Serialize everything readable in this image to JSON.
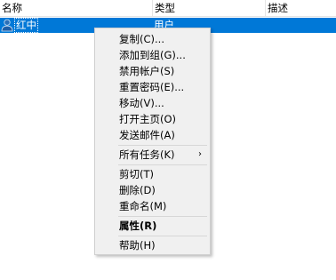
{
  "columns": {
    "name": "名称",
    "type": "类型",
    "description": "描述"
  },
  "selected_row": {
    "name": "红中",
    "type": "用户",
    "icon": "user-icon"
  },
  "menu": {
    "copy": "复制(C)...",
    "add_to_group": "添加到组(G)...",
    "disable_account": "禁用帐户(S)",
    "reset_password": "重置密码(E)...",
    "move": "移动(V)...",
    "open_home_page": "打开主页(O)",
    "send_mail": "发送邮件(A)",
    "all_tasks": "所有任务(K)",
    "all_tasks_arrow": "›",
    "cut": "剪切(T)",
    "delete": "删除(D)",
    "rename": "重命名(M)",
    "properties": "属性(R)",
    "help": "帮助(H)"
  },
  "colors": {
    "selection": "#0078d7",
    "menu_background": "#f0f0f0",
    "separator": "#d7d7d7"
  }
}
